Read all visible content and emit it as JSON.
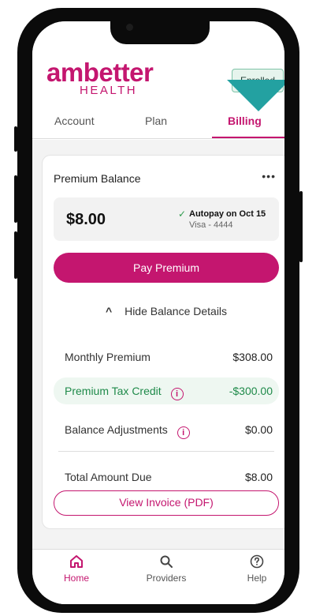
{
  "brand": {
    "name": "ambetter",
    "sub": "HEALTH",
    "color": "#c4166f"
  },
  "status_badge": "Enrolled",
  "tabs": [
    {
      "label": "Account",
      "active": false
    },
    {
      "label": "Plan",
      "active": false
    },
    {
      "label": "Billing",
      "active": true
    }
  ],
  "card": {
    "title": "Premium Balance",
    "more": "•••",
    "balance": "$8.00",
    "autopay_check": "✓",
    "autopay": "Autopay on Oct 15",
    "payment_method": "Visa - 4444",
    "pay_button": "Pay Premium",
    "toggle_icon": "^",
    "toggle_label": "Hide Balance Details",
    "rows": [
      {
        "label": "Monthly Premium",
        "value": "$308.00"
      },
      {
        "label": "Premium Tax Credit",
        "value": "-$300.00"
      },
      {
        "label": "Balance Adjustments",
        "value": "$0.00"
      },
      {
        "label": "Total Amount Due",
        "value": "$8.00"
      }
    ],
    "info_glyph": "i",
    "invoice_button": "View Invoice (PDF)"
  },
  "bottom_nav": [
    {
      "label": "Home",
      "icon": "home-icon",
      "active": true
    },
    {
      "label": "Providers",
      "icon": "search-icon",
      "active": false
    },
    {
      "label": "Help",
      "icon": "help-icon",
      "active": false
    }
  ],
  "colors": {
    "accent": "#c4166f",
    "credit": "#1f8a4a",
    "pointer": "#23a1a1"
  }
}
